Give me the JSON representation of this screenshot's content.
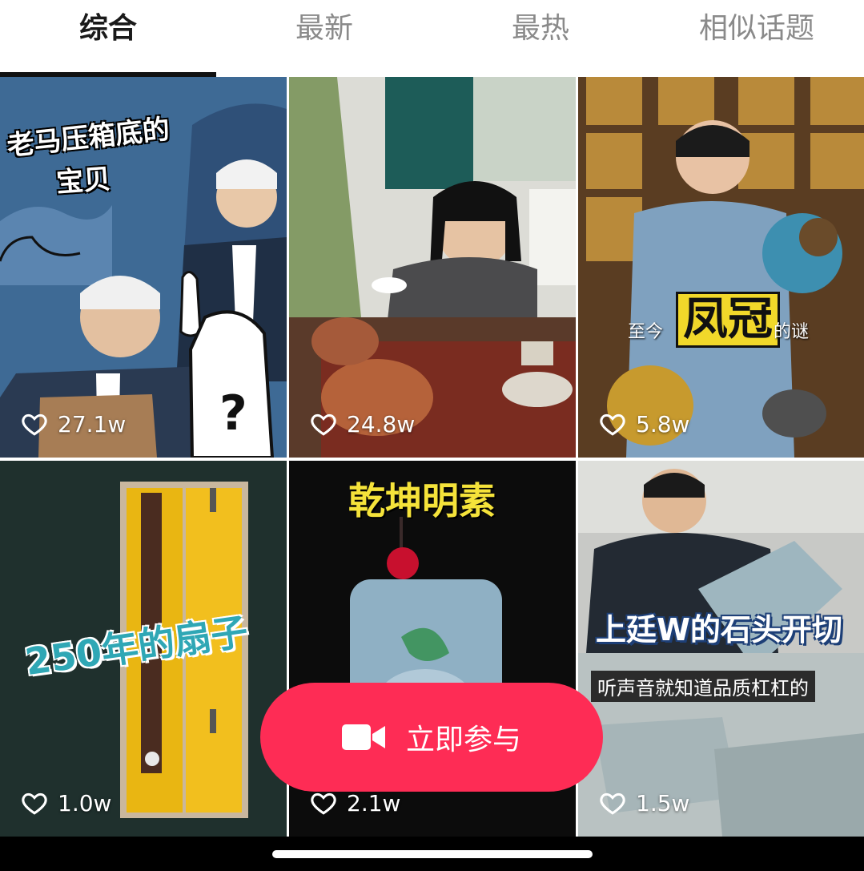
{
  "tabs": [
    {
      "label": "综合",
      "active": true
    },
    {
      "label": "最新",
      "active": false
    },
    {
      "label": "最热",
      "active": false
    },
    {
      "label": "相似话题",
      "active": false
    }
  ],
  "videos": [
    {
      "caption_lines": [
        "老马压箱底的",
        "宝贝"
      ],
      "likes": "27.1w"
    },
    {
      "caption_lines": [],
      "likes": "24.8w"
    },
    {
      "caption_big": "凤冠",
      "caption_pre": "至今",
      "caption_post": "的谜",
      "likes": "5.8w"
    },
    {
      "caption": "250年的扇子",
      "likes": "1.0w"
    },
    {
      "caption": "乾坤明素",
      "likes": "2.1w"
    },
    {
      "caption": "上廷W的石头开切",
      "subcaption": "听声音就知道品质杠杠的",
      "likes": "1.5w"
    }
  ],
  "join_button": {
    "label": "立即参与",
    "color": "#fe2c55",
    "icon": "video-camera-icon"
  },
  "colors": {
    "accent": "#fe2c55",
    "active_tab": "#1a1a1a",
    "inactive_tab": "#8a8a8a"
  }
}
